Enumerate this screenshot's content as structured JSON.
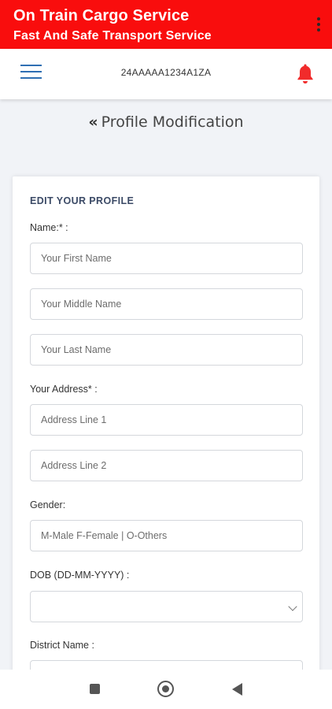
{
  "app": {
    "title": "On Train Cargo Service",
    "subtitle": "Fast And Safe Transport Service",
    "brand_color": "#f90d0d"
  },
  "topnav": {
    "gst_number": "24AAAAA1234A1ZA",
    "menu_icon": "hamburger-icon",
    "notification_icon": "bell-icon",
    "accent_color": "#2f6fb3"
  },
  "page": {
    "heading_chevron": "«",
    "heading": "Profile Modification"
  },
  "form": {
    "section_title": "EDIT YOUR PROFILE",
    "name_label": "Name:* :",
    "first_name_placeholder": "Your First Name",
    "middle_name_placeholder": "Your Middle Name",
    "last_name_placeholder": "Your Last Name",
    "address_label": "Your Address* :",
    "address_line1_placeholder": "Address Line 1",
    "address_line2_placeholder": "Address Line 2",
    "gender_label": "Gender:",
    "gender_placeholder": "M-Male F-Female | O-Others",
    "dob_label": "DOB (DD-MM-YYYY) :",
    "dob_value": "",
    "district_label": "District Name :"
  },
  "system_nav": {
    "recents_icon": "square-icon",
    "home_icon": "circle-icon",
    "back_icon": "back-triangle-icon"
  }
}
